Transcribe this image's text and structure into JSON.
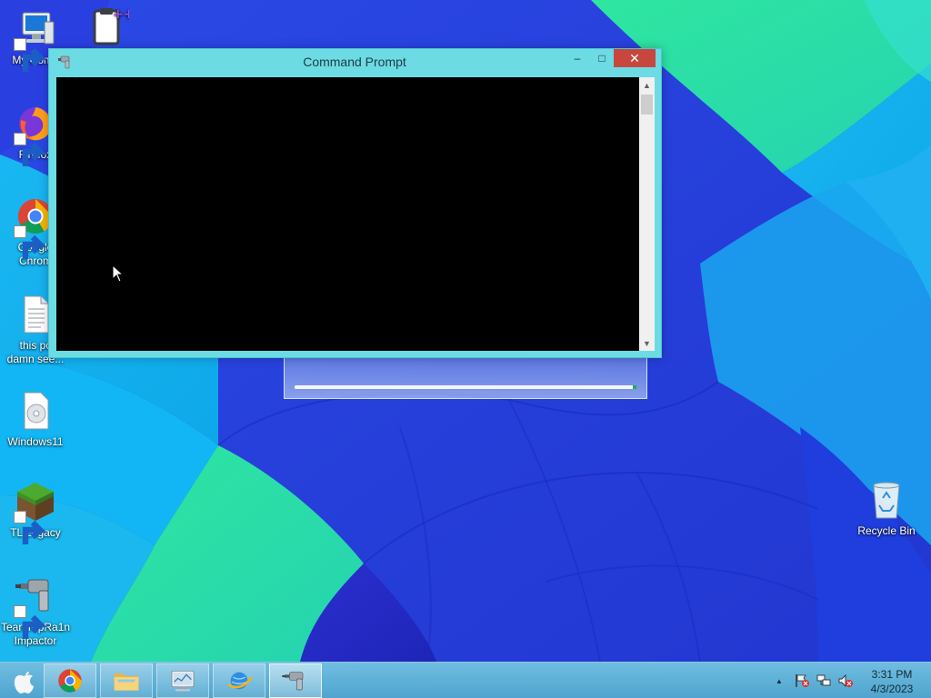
{
  "desktop": {
    "icons": [
      {
        "label": "My Comp",
        "icon": "computer-icon"
      },
      {
        "label": "",
        "icon": "clipboard-icon"
      },
      {
        "label": "Firefox",
        "icon": "firefox-icon"
      },
      {
        "label": "Google Chrom",
        "icon": "chrome-icon"
      },
      {
        "label": "this pc damn see...",
        "icon": "text-file-icon"
      },
      {
        "label": "Windows11",
        "icon": "disc-image-icon"
      },
      {
        "label": "TL Legacy",
        "icon": "minecraft-block-icon"
      },
      {
        "label": "TeardropRa1n Impactor",
        "icon": "impact-drill-icon"
      },
      {
        "label": "Recycle Bin",
        "icon": "recycle-bin-icon"
      }
    ]
  },
  "progress_window": {
    "progress": 0.99,
    "accent": "#11b84a"
  },
  "cmd_window": {
    "title": "Command Prompt",
    "minimize": "–",
    "maximize": "□",
    "close": "✕",
    "console_bg": "#000000",
    "frame_color": "#6ddbe3"
  },
  "taskbar": {
    "start_icon": "apple-logo-icon",
    "apps": [
      {
        "name": "Google Chrome",
        "icon": "chrome-icon"
      },
      {
        "name": "File Explorer",
        "icon": "folder-icon"
      },
      {
        "name": "Monitor",
        "icon": "monitor-icon"
      },
      {
        "name": "Internet",
        "icon": "globe-icon"
      },
      {
        "name": "TeardropRa1n Impactor",
        "icon": "impact-drill-icon"
      }
    ],
    "tray": {
      "show_hidden": "▲",
      "icons": [
        "action-center-flag-icon",
        "network-icon",
        "volume-muted-icon"
      ]
    },
    "clock": {
      "time": "3:31 PM",
      "date": "4/3/2023"
    }
  }
}
